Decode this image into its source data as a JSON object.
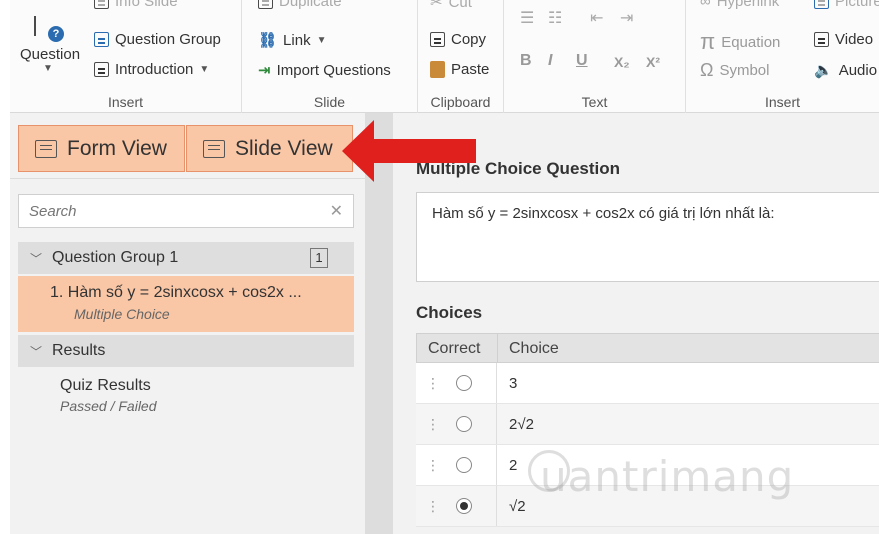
{
  "ribbon": {
    "insert_group": {
      "question_label": "Question",
      "info_slide": "Info Slide",
      "question_group": "Question Group",
      "introduction": "Introduction",
      "label": "Insert"
    },
    "slide_group": {
      "duplicate": "Duplicate",
      "link": "Link",
      "import_questions": "Import Questions",
      "label": "Slide"
    },
    "clipboard_group": {
      "cut": "Cut",
      "copy": "Copy",
      "paste": "Paste",
      "label": "Clipboard"
    },
    "text_group": {
      "bold": "B",
      "italic": "I",
      "underline": "U",
      "subscript": "X₂",
      "superscript": "X²",
      "label": "Text"
    },
    "insert2_group": {
      "hyperlink": "Hyperlink",
      "equation": "Equation",
      "symbol": "Symbol",
      "picture": "Picture",
      "video": "Video",
      "audio": "Audio",
      "label": "Insert"
    }
  },
  "views": {
    "form_view": "Form View",
    "slide_view": "Slide View"
  },
  "search": {
    "placeholder": "Search"
  },
  "tree": {
    "group_name": "Question Group 1",
    "group_count": "1",
    "question_item": "1.  Hàm số y = 2sinxcosx + cos2x ...",
    "question_type": "Multiple Choice",
    "results_header": "Results",
    "results_item": "Quiz Results",
    "results_sub": "Passed / Failed"
  },
  "editor": {
    "section_title": "Multiple Choice Question",
    "question_text": "Hàm số y = 2sinxcosx + cos2x có giá trị lớn nhất là:",
    "choices_title": "Choices",
    "col_correct": "Correct",
    "col_choice": "Choice",
    "choices": [
      {
        "text": "3",
        "correct": false
      },
      {
        "text": "2√2",
        "correct": false
      },
      {
        "text": "2",
        "correct": false
      },
      {
        "text": "√2",
        "correct": true
      }
    ]
  },
  "watermark": "uantrimang",
  "colors": {
    "accent_tab": "#f9c6a6",
    "arrow": "#e0201c",
    "brand_blue": "#2b6cb0"
  }
}
